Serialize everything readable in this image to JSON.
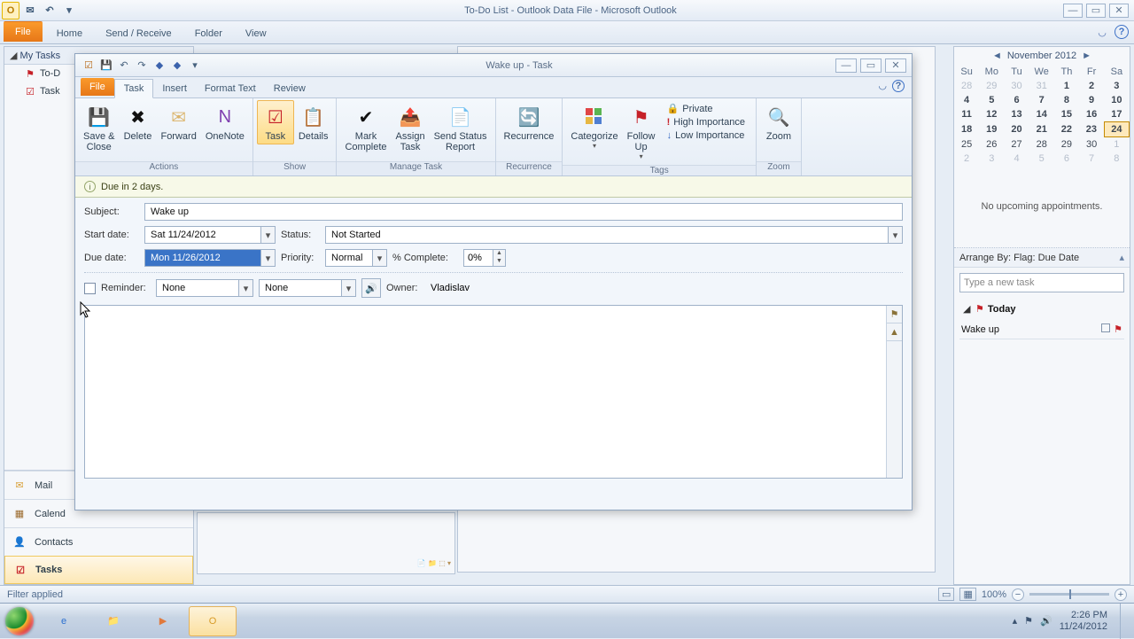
{
  "app_title": "To-Do List - Outlook Data File - Microsoft Outlook",
  "main_tabs": {
    "file": "File",
    "home": "Home",
    "send_receive": "Send / Receive",
    "folder": "Folder",
    "view": "View"
  },
  "left_nav": {
    "header": "My Tasks",
    "items": [
      "To-D",
      "Task"
    ]
  },
  "folders": {
    "mail": "Mail",
    "calendar": "Calend",
    "contacts": "Contacts",
    "tasks": "Tasks"
  },
  "task_window": {
    "title": "Wake up - Task",
    "tabs": {
      "file": "File",
      "task": "Task",
      "insert": "Insert",
      "format": "Format Text",
      "review": "Review"
    },
    "groups": {
      "actions": {
        "label": "Actions",
        "save_close": "Save &\nClose",
        "delete": "Delete",
        "forward": "Forward",
        "onenote": "OneNote"
      },
      "show": {
        "label": "Show",
        "task": "Task",
        "details": "Details"
      },
      "manage": {
        "label": "Manage Task",
        "mark_complete": "Mark\nComplete",
        "assign_task": "Assign\nTask",
        "send_status": "Send Status\nReport"
      },
      "recurrence": {
        "label": "Recurrence",
        "btn": "Recurrence"
      },
      "tags": {
        "label": "Tags",
        "categorize": "Categorize",
        "follow_up": "Follow\nUp",
        "private": "Private",
        "high": "High Importance",
        "low": "Low Importance"
      },
      "zoom": {
        "label": "Zoom",
        "btn": "Zoom"
      }
    },
    "info_bar": "Due in 2 days.",
    "form": {
      "subject_label": "Subject:",
      "subject": "Wake up",
      "start_label": "Start date:",
      "start": "Sat 11/24/2012",
      "due_label": "Due date:",
      "due": "Mon 11/26/2012",
      "status_label": "Status:",
      "status": "Not Started",
      "priority_label": "Priority:",
      "priority": "Normal",
      "pct_label": "% Complete:",
      "pct": "0%",
      "reminder_label": "Reminder:",
      "reminder_date": "None",
      "reminder_time": "None",
      "owner_label": "Owner:",
      "owner": "Vladislav"
    }
  },
  "calendar": {
    "month": "November 2012",
    "dow": [
      "Su",
      "Mo",
      "Tu",
      "We",
      "Th",
      "Fr",
      "Sa"
    ],
    "rows": [
      [
        {
          "d": "28",
          "dim": true
        },
        {
          "d": "29",
          "dim": true
        },
        {
          "d": "30",
          "dim": true
        },
        {
          "d": "31",
          "dim": true
        },
        {
          "d": "1",
          "bold": true
        },
        {
          "d": "2",
          "bold": true
        },
        {
          "d": "3",
          "bold": true
        }
      ],
      [
        {
          "d": "4",
          "bold": true
        },
        {
          "d": "5",
          "bold": true
        },
        {
          "d": "6",
          "bold": true
        },
        {
          "d": "7",
          "bold": true
        },
        {
          "d": "8",
          "bold": true
        },
        {
          "d": "9",
          "bold": true
        },
        {
          "d": "10",
          "bold": true
        }
      ],
      [
        {
          "d": "11",
          "bold": true
        },
        {
          "d": "12",
          "bold": true
        },
        {
          "d": "13",
          "bold": true
        },
        {
          "d": "14",
          "bold": true
        },
        {
          "d": "15",
          "bold": true
        },
        {
          "d": "16",
          "bold": true
        },
        {
          "d": "17",
          "bold": true
        }
      ],
      [
        {
          "d": "18",
          "bold": true
        },
        {
          "d": "19",
          "bold": true
        },
        {
          "d": "20",
          "bold": true
        },
        {
          "d": "21",
          "bold": true
        },
        {
          "d": "22",
          "bold": true
        },
        {
          "d": "23",
          "bold": true
        },
        {
          "d": "24",
          "today": true
        }
      ],
      [
        {
          "d": "25"
        },
        {
          "d": "26"
        },
        {
          "d": "27"
        },
        {
          "d": "28"
        },
        {
          "d": "29"
        },
        {
          "d": "30"
        },
        {
          "d": "1",
          "dim": true
        }
      ],
      [
        {
          "d": "2",
          "dim": true
        },
        {
          "d": "3",
          "dim": true
        },
        {
          "d": "4",
          "dim": true
        },
        {
          "d": "5",
          "dim": true
        },
        {
          "d": "6",
          "dim": true
        },
        {
          "d": "7",
          "dim": true
        },
        {
          "d": "8",
          "dim": true
        }
      ]
    ],
    "no_appt": "No upcoming appointments.",
    "arrange": "Arrange By: Flag: Due Date",
    "new_task_placeholder": "Type a new task",
    "today_label": "Today",
    "task_item": "Wake up"
  },
  "statusbar": {
    "filter": "Filter applied",
    "zoom": "100%"
  },
  "tray": {
    "time": "2:26 PM",
    "date": "11/24/2012"
  }
}
